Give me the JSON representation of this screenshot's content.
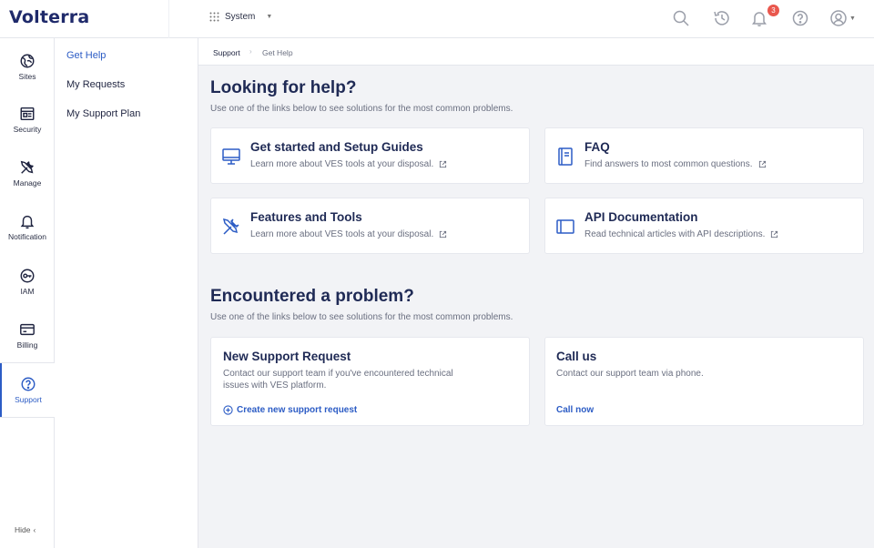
{
  "app": {
    "logo": "Volterra"
  },
  "topbar": {
    "system_label": "System",
    "notification_count": "3"
  },
  "rail": {
    "items": [
      {
        "label": "Sites",
        "icon": "sites-icon"
      },
      {
        "label": "Security",
        "icon": "security-icon"
      },
      {
        "label": "Manage",
        "icon": "manage-icon"
      },
      {
        "label": "Notification",
        "icon": "notification-icon"
      },
      {
        "label": "IAM",
        "icon": "iam-icon"
      },
      {
        "label": "Billing",
        "icon": "billing-icon"
      },
      {
        "label": "Support",
        "icon": "support-icon"
      }
    ],
    "hide_label": "Hide"
  },
  "subnav": {
    "items": [
      {
        "label": "Get Help"
      },
      {
        "label": "My Requests"
      },
      {
        "label": "My Support Plan"
      }
    ]
  },
  "breadcrumb": {
    "items": [
      "Support",
      "Get Help"
    ]
  },
  "help_section": {
    "title": "Looking for help?",
    "subtitle": "Use one of the links below to see solutions for the most common problems.",
    "cards": [
      {
        "title": "Get started and Setup Guides",
        "desc": "Learn more about VES tools at your disposal.",
        "icon": "monitor-icon"
      },
      {
        "title": "FAQ",
        "desc": "Find answers to most common questions.",
        "icon": "book-icon"
      },
      {
        "title": "Features and Tools",
        "desc": "Learn more about VES tools at your disposal.",
        "icon": "tools-icon"
      },
      {
        "title": "API Documentation",
        "desc": "Read technical articles with API descriptions.",
        "icon": "panel-icon"
      }
    ]
  },
  "problem_section": {
    "title": "Encountered a problem?",
    "subtitle": "Use one of the links below to see solutions for the most common problems.",
    "request_card": {
      "title": "New Support Request",
      "body_line1": "Contact our support team if you've encountered technical",
      "body_line2": "issues with VES platform.",
      "link": "Create new support request"
    },
    "call_card": {
      "title": "Call us",
      "body": "Contact our support team via phone.",
      "link": "Call now"
    }
  },
  "colors": {
    "accent": "#2c5cc5",
    "brand": "#1f2a6b",
    "badge": "#e9574d"
  }
}
